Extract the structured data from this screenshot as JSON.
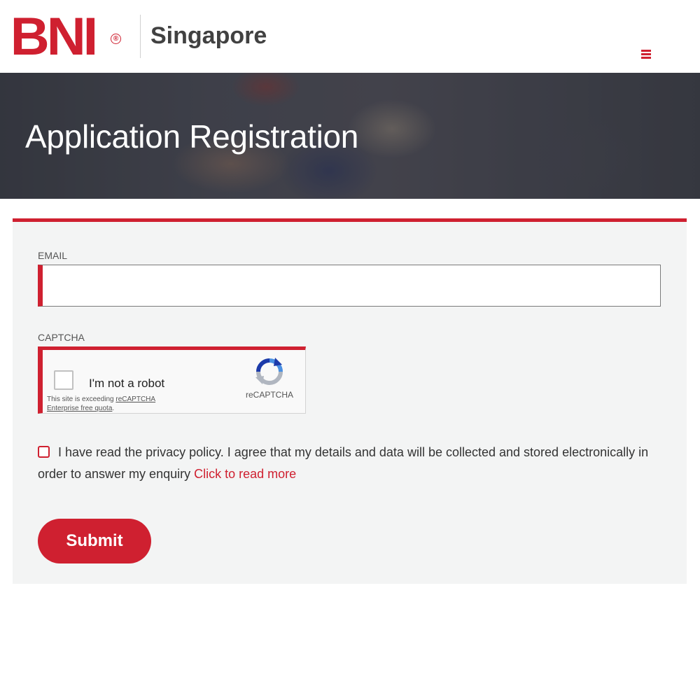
{
  "header": {
    "logo_text": "BNI",
    "logo_mark": "®",
    "region": "Singapore",
    "menu_icon": "hamburger-menu-icon"
  },
  "banner": {
    "title": "Application Registration"
  },
  "form": {
    "email_label": "EMAIL",
    "email_value": "",
    "captcha_label": "CAPTCHA",
    "recaptcha": {
      "checkbox_label": "I'm not a robot",
      "note_prefix": "This site is exceeding ",
      "note_link": "reCAPTCHA Enterprise free quota",
      "note_suffix": ".",
      "brand": "reCAPTCHA"
    },
    "consent_text": "I have read the privacy policy. I agree that my details and data will be collected and stored electronically in order to answer my enquiry ",
    "consent_link": "Click to read more",
    "submit_label": "Submit"
  },
  "colors": {
    "brand_red": "#cf2030",
    "card_bg": "#f3f4f4"
  }
}
